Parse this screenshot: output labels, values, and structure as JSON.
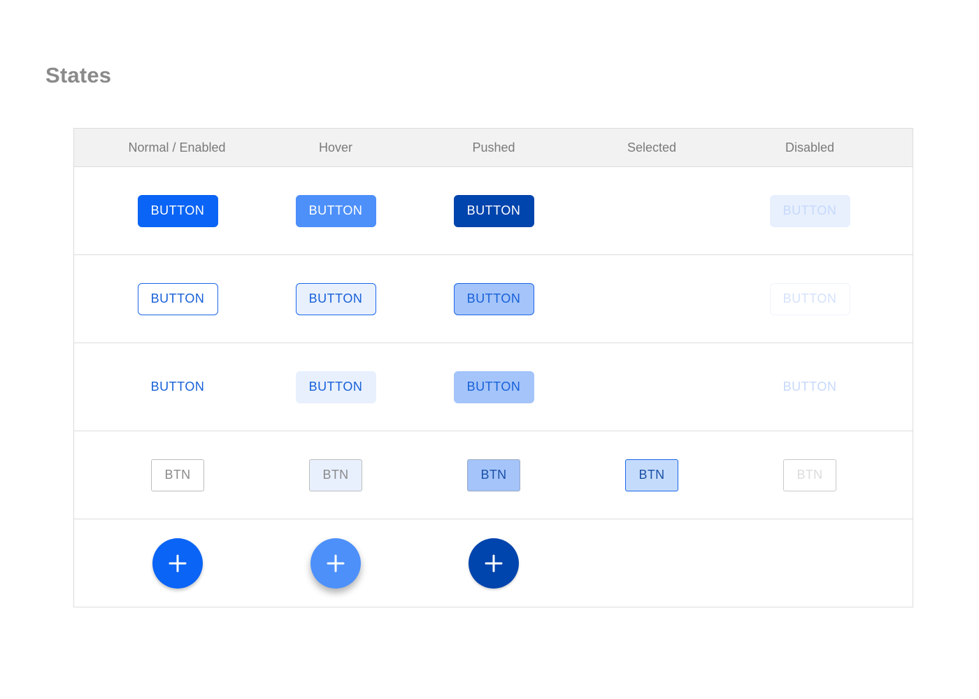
{
  "page": {
    "title": "States"
  },
  "columns": [
    "Normal / Enabled",
    "Hover",
    "Pushed",
    "Selected",
    "Disabled"
  ],
  "rows": {
    "filled": {
      "normal": "BUTTON",
      "hover": "BUTTON",
      "pushed": "BUTTON",
      "disabled": "BUTTON"
    },
    "outlined": {
      "normal": "BUTTON",
      "hover": "BUTTON",
      "pushed": "BUTTON",
      "disabled": "BUTTON"
    },
    "text": {
      "normal": "BUTTON",
      "hover": "BUTTON",
      "pushed": "BUTTON",
      "disabled": "BUTTON"
    },
    "small": {
      "normal": "BTN",
      "hover": "BTN",
      "pushed": "BTN",
      "selected": "BTN",
      "disabled": "BTN"
    },
    "fab": {
      "icon": "plus-icon"
    }
  },
  "colors": {
    "primary": "#0a64f5",
    "hover": "#4d90fa",
    "pushed": "#0044ad",
    "light_tint": "#e8f0fe",
    "pushed_tint": "#a4c4fa",
    "selected_tint": "#c4dbfb",
    "disabled_text": "#c6d8fb",
    "title_gray": "#8a8a8a",
    "header_bg": "#f2f2f2"
  }
}
